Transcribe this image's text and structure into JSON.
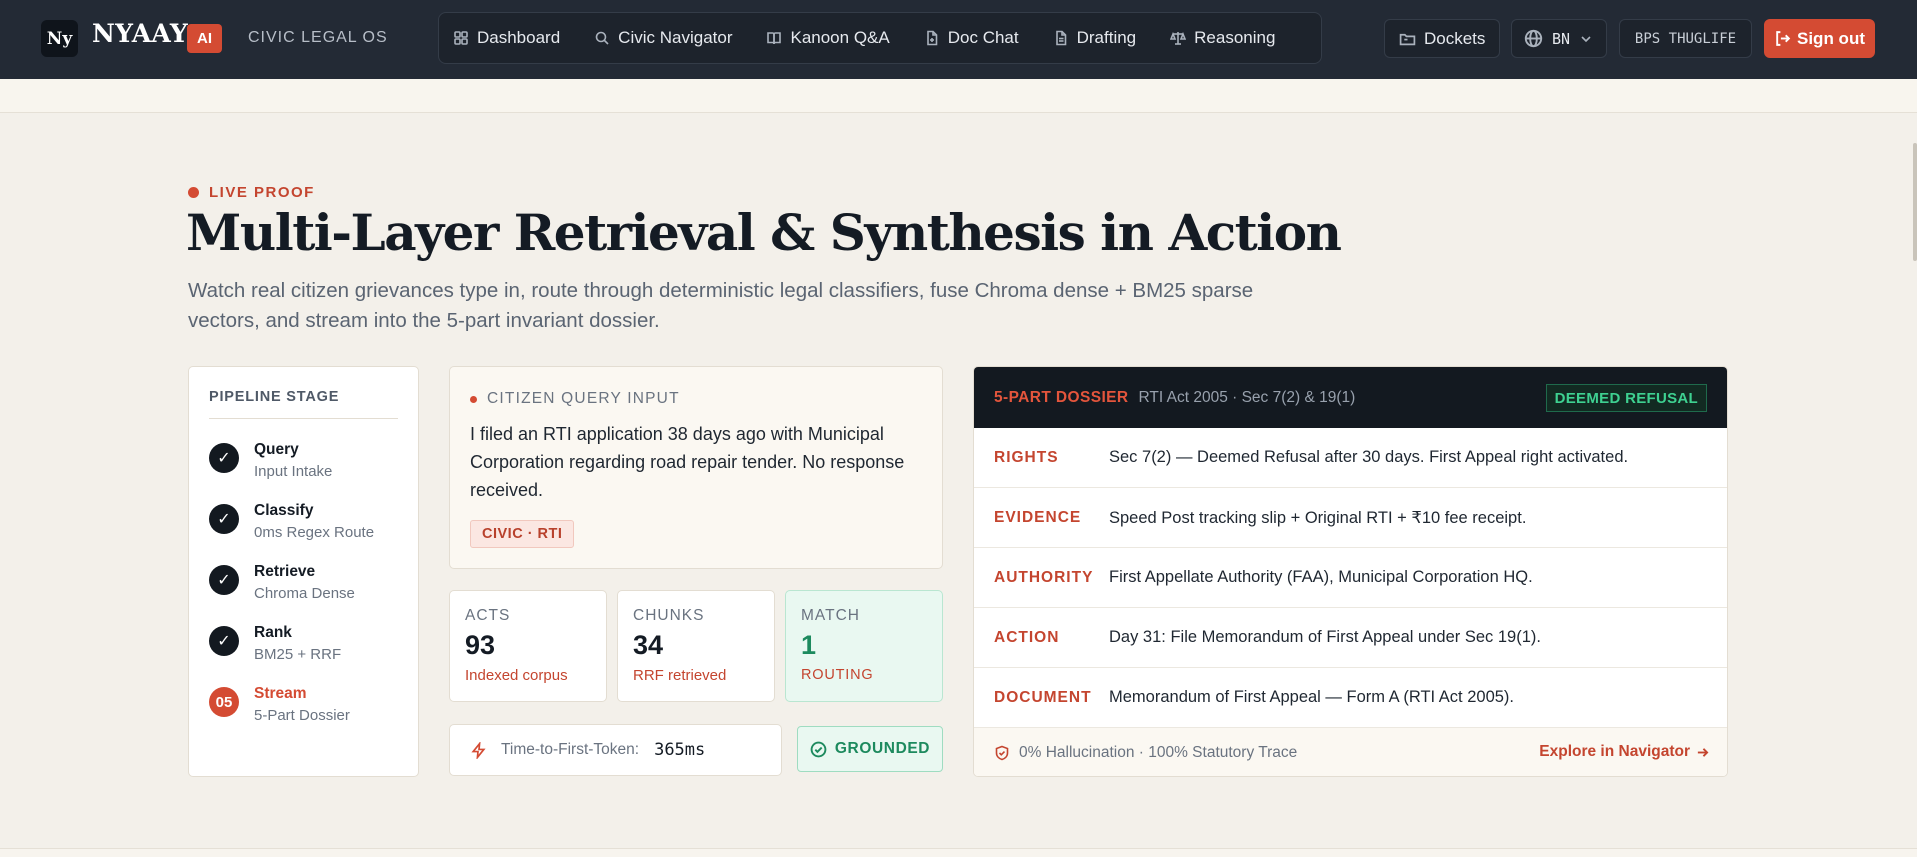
{
  "header": {
    "logo_text": "Ny",
    "brand": "NYAAY",
    "ai_badge": "AI",
    "tagline": "CIVIC LEGAL OS",
    "nav": [
      {
        "label": "Dashboard",
        "icon": "grid-icon"
      },
      {
        "label": "Civic Navigator",
        "icon": "search-icon"
      },
      {
        "label": "Kanoon Q&A",
        "icon": "book-icon"
      },
      {
        "label": "Doc Chat",
        "icon": "file-chat-icon"
      },
      {
        "label": "Drafting",
        "icon": "document-icon"
      },
      {
        "label": "Reasoning",
        "icon": "scales-icon"
      }
    ],
    "dockets_label": "Dockets",
    "language": "BN",
    "user": "BPS THUGLIFE",
    "signout_label": "Sign out"
  },
  "hero": {
    "eyebrow": "LIVE PROOF",
    "title": "Multi-Layer Retrieval & Synthesis in Action",
    "subtitle": "Watch real citizen grievances type in, route through deterministic legal classifiers, fuse Chroma dense + BM25 sparse vectors, and stream into the 5-part invariant dossier."
  },
  "pipeline": {
    "heading": "PIPELINE STAGE",
    "steps": [
      {
        "marker": "✓",
        "name": "Query",
        "desc": "Input Intake"
      },
      {
        "marker": "✓",
        "name": "Classify",
        "desc": "0ms Regex Route"
      },
      {
        "marker": "✓",
        "name": "Retrieve",
        "desc": "Chroma Dense"
      },
      {
        "marker": "✓",
        "name": "Rank",
        "desc": "BM25 + RRF"
      },
      {
        "marker": "05",
        "name": "Stream",
        "desc": "5-Part Dossier"
      }
    ]
  },
  "query": {
    "heading": "CITIZEN QUERY INPUT",
    "text": "I filed an RTI application 38 days ago with Municipal Corporation regarding road repair tender. No response received.",
    "tag": "CIVIC · RTI"
  },
  "stats": [
    {
      "label": "ACTS",
      "value": "93",
      "desc": "Indexed corpus"
    },
    {
      "label": "CHUNKS",
      "value": "34",
      "desc": "RRF retrieved"
    },
    {
      "label": "MATCH",
      "value": "1",
      "desc": "ROUTING"
    }
  ],
  "ttft": {
    "label": "Time-to-First-Token:",
    "value": "365ms"
  },
  "grounded_label": "GROUNDED",
  "dossier": {
    "title": "5-PART DOSSIER",
    "meta": "RTI Act 2005 · Sec 7(2) & 19(1)",
    "status": "DEEMED REFUSAL",
    "rows": [
      {
        "key": "RIGHTS",
        "value": "Sec 7(2) — Deemed Refusal after 30 days. First Appeal right activated."
      },
      {
        "key": "EVIDENCE",
        "value": "Speed Post tracking slip + Original RTI + ₹10 fee receipt."
      },
      {
        "key": "AUTHORITY",
        "value": "First Appellate Authority (FAA), Municipal Corporation HQ."
      },
      {
        "key": "ACTION",
        "value": "Day 31: File Memorandum of First Appeal under Sec 19(1)."
      },
      {
        "key": "DOCUMENT",
        "value": "Memorandum of First Appeal — Form A (RTI Act 2005)."
      }
    ],
    "footer": "0% Hallucination · 100% Statutory Trace",
    "explore_label": "Explore in Navigator"
  },
  "colors": {
    "accent": "#d44b33",
    "nav_bg": "#232a35",
    "success": "#1d8a5e",
    "page_bg": "#f3f0ea"
  }
}
